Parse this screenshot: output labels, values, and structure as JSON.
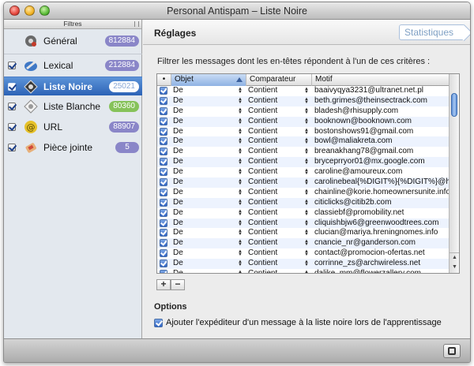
{
  "window": {
    "title": "Personal Antispam – Liste Noire"
  },
  "sidebar": {
    "header": "Filtres",
    "items": [
      {
        "label": "Général",
        "count": "812884",
        "icon": "gear-icon",
        "checkbox": false,
        "color": "#8a86c8"
      },
      {
        "label": "Lexical",
        "count": "212884",
        "icon": "lexical-icon",
        "checkbox": true,
        "color": "#8a86c8"
      },
      {
        "label": "Liste Noire",
        "count": "25021",
        "icon": "blacklist-icon",
        "checkbox": true,
        "color": "#ffffff"
      },
      {
        "label": "Liste Blanche",
        "count": "80360",
        "icon": "whitelist-icon",
        "checkbox": true,
        "color": "#86c25a"
      },
      {
        "label": "URL",
        "count": "88907",
        "icon": "url-icon",
        "checkbox": true,
        "color": "#8a86c8"
      },
      {
        "label": "Pièce jointe",
        "count": "5",
        "icon": "attachment-icon",
        "checkbox": true,
        "color": "#8a86c8"
      }
    ]
  },
  "main": {
    "title": "Réglages",
    "stats_button": "Statistiques",
    "instruction": "Filtrer les messages dont les en-têtes répondent à l'un de ces critères :",
    "columns": {
      "sel": "•",
      "objet": "Objet",
      "comparateur": "Comparateur",
      "motif": "Motif"
    },
    "rows": [
      {
        "objet": "De",
        "comparateur": "Contient",
        "motif": "baaivyqya3231@ultranet.net.pl"
      },
      {
        "objet": "De",
        "comparateur": "Contient",
        "motif": "beth.grimes@theinsectrack.com"
      },
      {
        "objet": "De",
        "comparateur": "Contient",
        "motif": "bladesh@rhisupply.com"
      },
      {
        "objet": "De",
        "comparateur": "Contient",
        "motif": "booknown@booknown.com"
      },
      {
        "objet": "De",
        "comparateur": "Contient",
        "motif": "bostonshows91@gmail.com"
      },
      {
        "objet": "De",
        "comparateur": "Contient",
        "motif": "bowl@maliakreta.com"
      },
      {
        "objet": "De",
        "comparateur": "Contient",
        "motif": "breanakhang78@gmail.com"
      },
      {
        "objet": "De",
        "comparateur": "Contient",
        "motif": "bryceprryor01@mx.google.com"
      },
      {
        "objet": "De",
        "comparateur": "Contient",
        "motif": "caroline@amoureux.com"
      },
      {
        "objet": "De",
        "comparateur": "Contient",
        "motif": "carolinebeal{%DIGIT%}{%DIGIT%}@hotmail.c"
      },
      {
        "objet": "De",
        "comparateur": "Contient",
        "motif": "chainline@korie.homeownersunite.info"
      },
      {
        "objet": "De",
        "comparateur": "Contient",
        "motif": "citiclicks@citib2b.com"
      },
      {
        "objet": "De",
        "comparateur": "Contient",
        "motif": "classiebf@promobility.net"
      },
      {
        "objet": "De",
        "comparateur": "Contient",
        "motif": "cliquishbjw6@greenwoodtrees.com"
      },
      {
        "objet": "De",
        "comparateur": "Contient",
        "motif": "clucian@mariya.hreningnomes.info"
      },
      {
        "objet": "De",
        "comparateur": "Contient",
        "motif": "cnancie_nr@ganderson.com"
      },
      {
        "objet": "De",
        "comparateur": "Contient",
        "motif": "contact@promocion-ofertas.net"
      },
      {
        "objet": "De",
        "comparateur": "Contient",
        "motif": "corrinne_zs@archwireless.net"
      },
      {
        "objet": "De",
        "comparateur": "Contient",
        "motif": "dalike_mm@flowerzallery.com"
      }
    ],
    "add_button": "+",
    "remove_button": "−",
    "options_title": "Options",
    "options_checkbox_label": "Ajouter l'expéditeur d'un message à la liste noire lors de l'apprentissage"
  },
  "colors": {
    "selection": "#2c63b6",
    "badge_purple": "#8a86c8",
    "badge_green": "#86c25a"
  }
}
